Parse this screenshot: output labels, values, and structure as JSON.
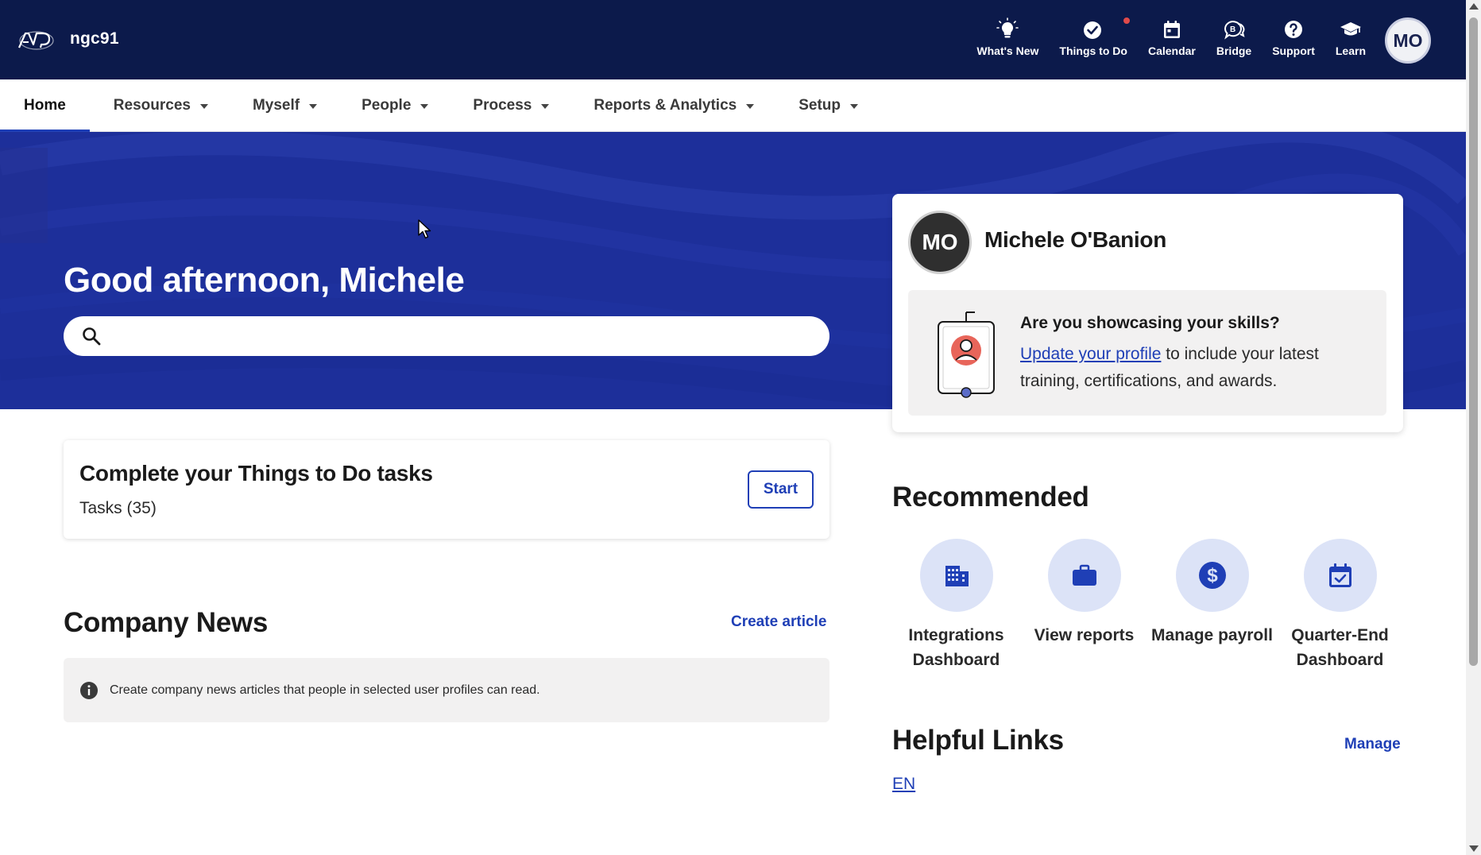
{
  "header": {
    "logo": "ADP",
    "company": "ngc91",
    "tools": [
      {
        "label": "What's New",
        "icon": "lightbulb-icon"
      },
      {
        "label": "Things to Do",
        "icon": "check-circle-icon"
      },
      {
        "label": "Calendar",
        "icon": "calendar-icon"
      },
      {
        "label": "Bridge",
        "icon": "bridge-icon"
      },
      {
        "label": "Support",
        "icon": "question-icon"
      },
      {
        "label": "Learn",
        "icon": "graduation-cap-icon"
      }
    ],
    "avatar_initials": "MO"
  },
  "nav": {
    "items": [
      {
        "label": "Home"
      },
      {
        "label": "Resources"
      },
      {
        "label": "Myself"
      },
      {
        "label": "People"
      },
      {
        "label": "Process"
      },
      {
        "label": "Reports & Analytics"
      },
      {
        "label": "Setup"
      }
    ]
  },
  "hero": {
    "greeting": "Good afternoon, Michele",
    "search_placeholder": ""
  },
  "profile": {
    "initials": "MO",
    "name": "Michele O'Banion",
    "skills_title": "Are you showcasing your skills?",
    "skills_link": "Update your profile",
    "skills_text": " to include your latest training, certifications, and awards."
  },
  "todo": {
    "title": "Complete your Things to Do tasks",
    "tasks": "Tasks (35)",
    "button": "Start"
  },
  "news": {
    "title": "Company News",
    "create_link": "Create article",
    "info": "Create company news articles that people in selected user profiles can read."
  },
  "recommended": {
    "title": "Recommended",
    "items": [
      {
        "label": "Integrations Dashboard",
        "icon": "building-icon"
      },
      {
        "label": "View reports",
        "icon": "briefcase-icon"
      },
      {
        "label": "Manage payroll",
        "icon": "dollar-icon"
      },
      {
        "label": "Quarter-End Dashboard",
        "icon": "calendar-check-icon"
      }
    ]
  },
  "helpful_links": {
    "title": "Helpful Links",
    "manage": "Manage",
    "links": [
      "EN"
    ]
  },
  "colors": {
    "header_bg": "#0c1a4b",
    "hero_bg": "#1d2f9a",
    "accent": "#1f3fb6",
    "icon_circle": "#dce3f7"
  }
}
